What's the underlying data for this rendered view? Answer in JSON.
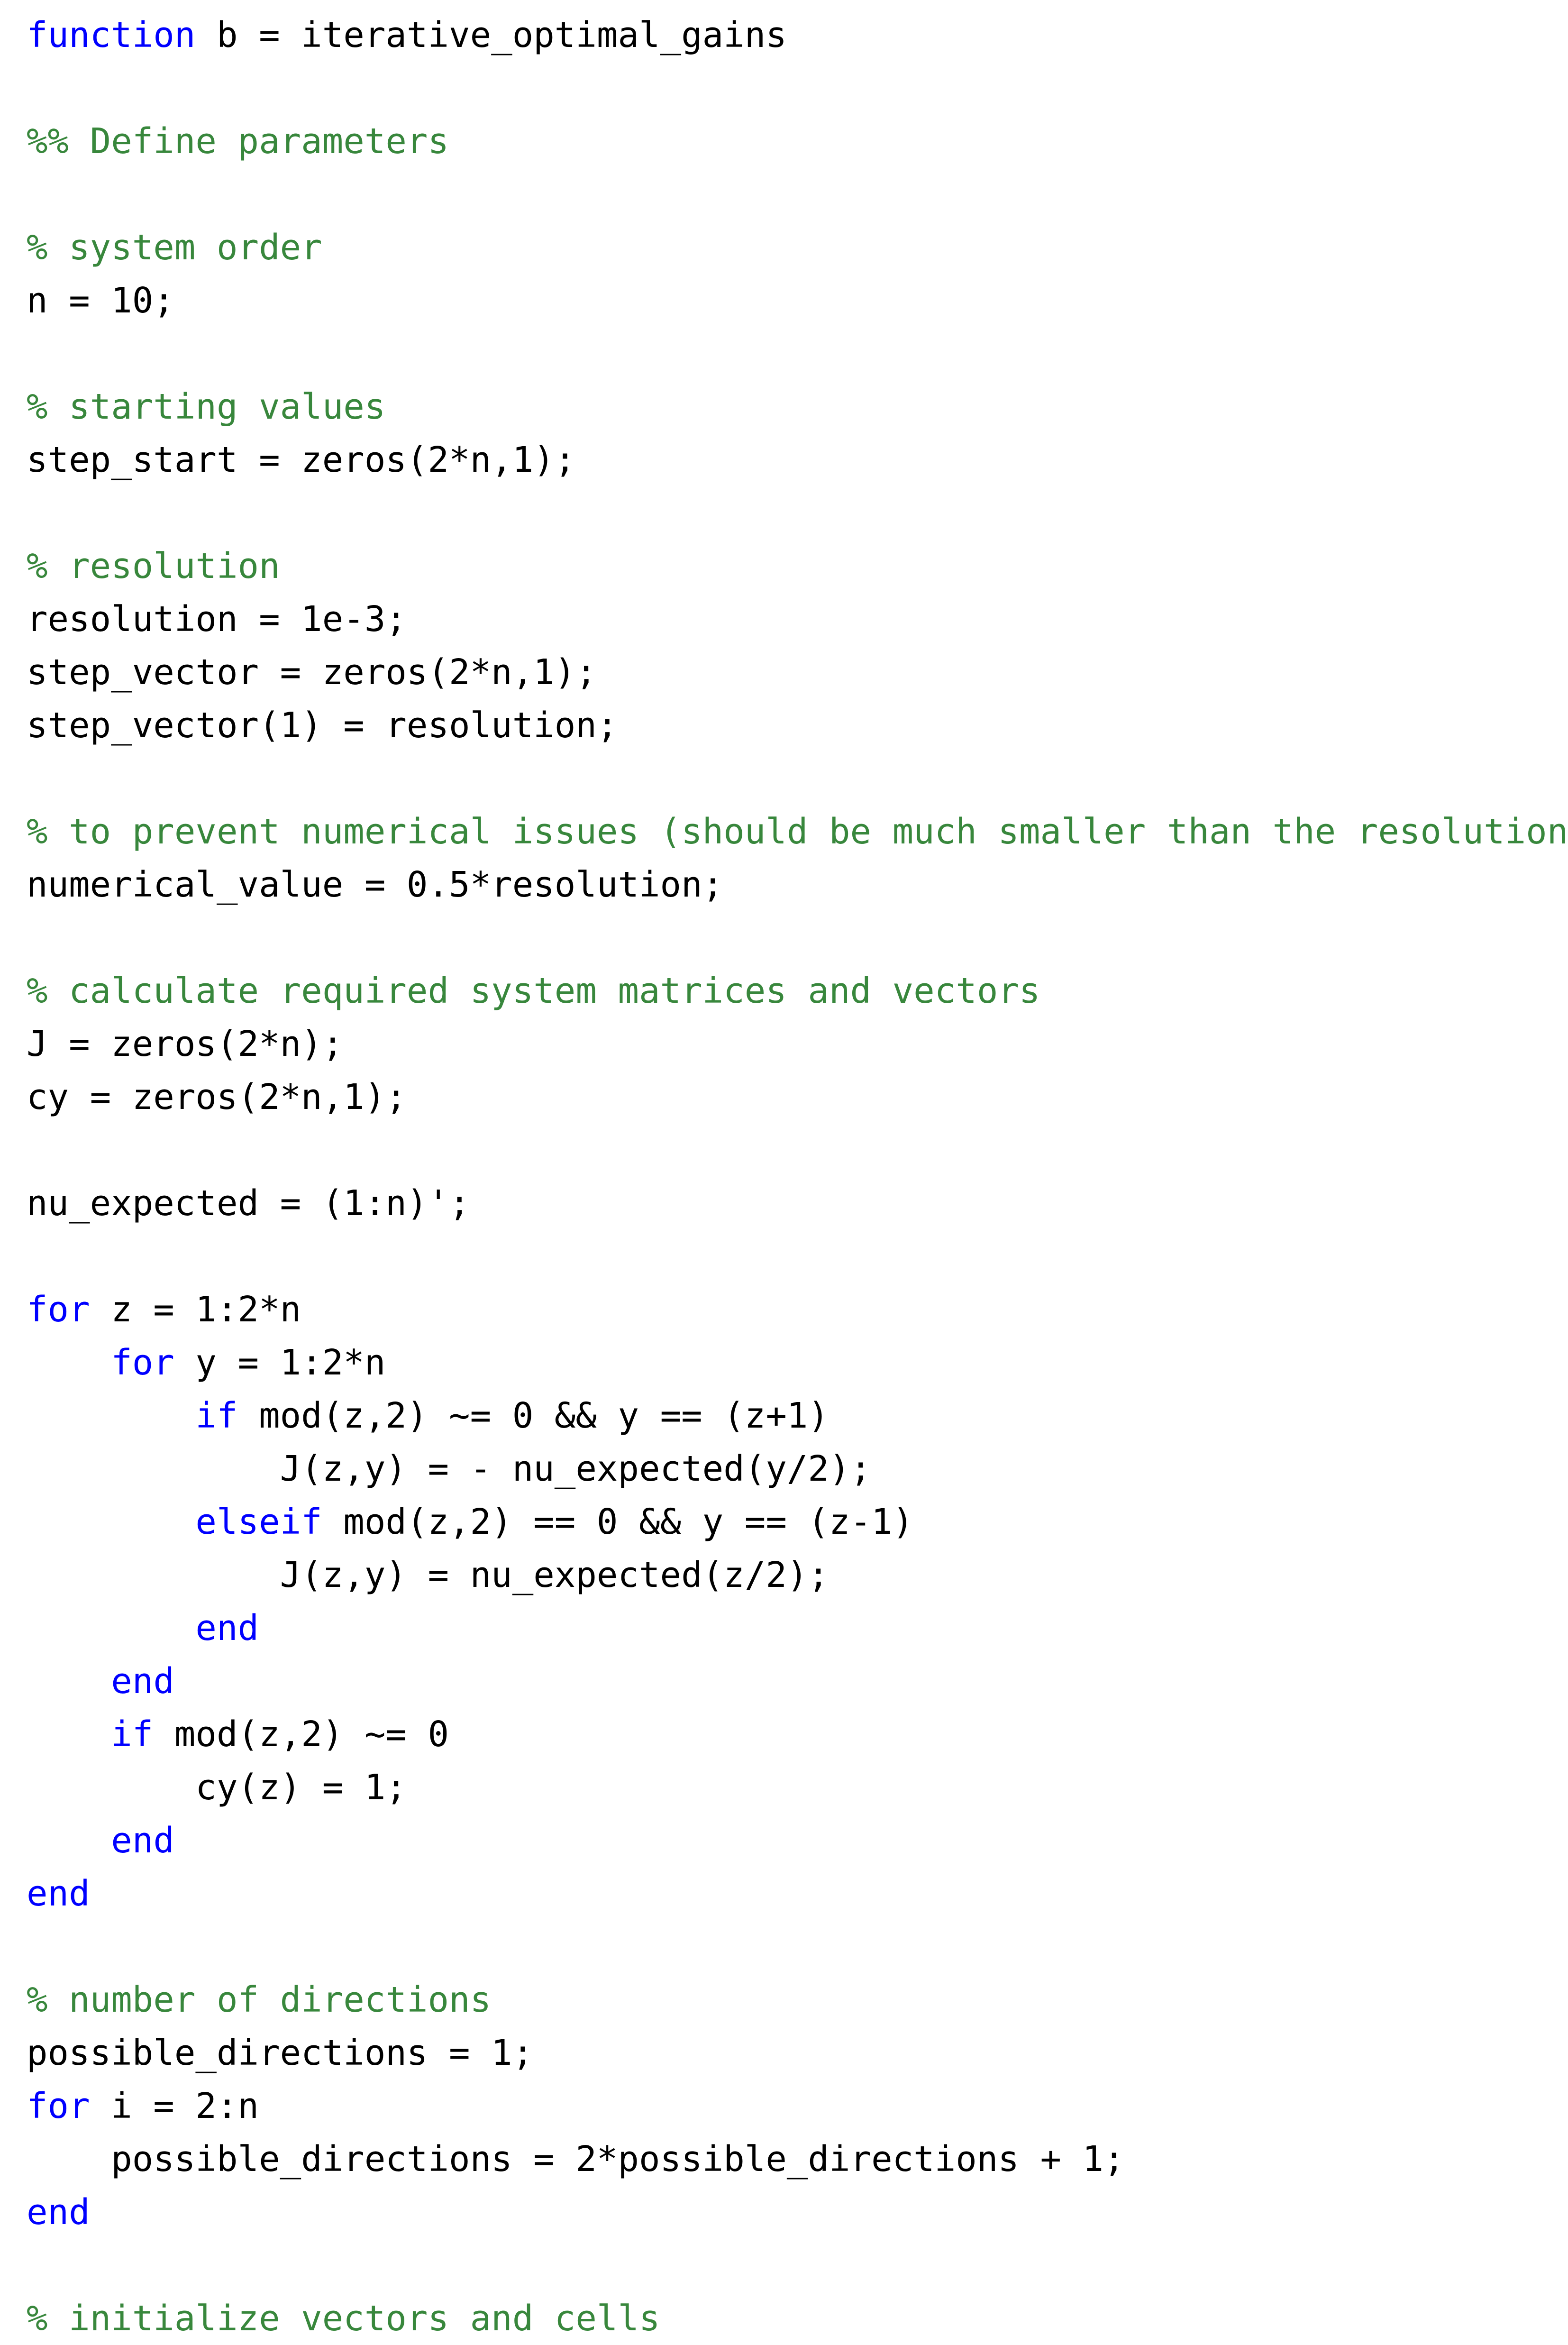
{
  "document": {
    "kind": "matlab-source-listing",
    "function_name": "iterative_optimal_gains",
    "colors": {
      "keyword": "#0000ff",
      "comment": "#38873c",
      "code": "#000000",
      "background": "#ffffff"
    }
  },
  "lines": [
    {
      "id": "l1",
      "indent": 0,
      "tokens": [
        {
          "t": "function",
          "k": "kw"
        },
        {
          "t": " b = iterative_optimal_gains",
          "k": "plain"
        }
      ]
    },
    {
      "id": "l2",
      "indent": 0,
      "tokens": []
    },
    {
      "id": "l3",
      "indent": 0,
      "tokens": [
        {
          "t": "%% Define parameters",
          "k": "comment"
        }
      ]
    },
    {
      "id": "l4",
      "indent": 0,
      "tokens": []
    },
    {
      "id": "l5",
      "indent": 0,
      "tokens": [
        {
          "t": "% system order",
          "k": "comment"
        }
      ]
    },
    {
      "id": "l6",
      "indent": 0,
      "tokens": [
        {
          "t": "n = 10;",
          "k": "plain"
        }
      ]
    },
    {
      "id": "l7",
      "indent": 0,
      "tokens": []
    },
    {
      "id": "l8",
      "indent": 0,
      "tokens": [
        {
          "t": "% starting values",
          "k": "comment"
        }
      ]
    },
    {
      "id": "l9",
      "indent": 0,
      "tokens": [
        {
          "t": "step_start = zeros(2*n,1);",
          "k": "plain"
        }
      ]
    },
    {
      "id": "l10",
      "indent": 0,
      "tokens": []
    },
    {
      "id": "l11",
      "indent": 0,
      "tokens": [
        {
          "t": "% resolution",
          "k": "comment"
        }
      ]
    },
    {
      "id": "l12",
      "indent": 0,
      "tokens": [
        {
          "t": "resolution = 1e-3;",
          "k": "plain"
        }
      ]
    },
    {
      "id": "l13",
      "indent": 0,
      "tokens": [
        {
          "t": "step_vector = zeros(2*n,1);",
          "k": "plain"
        }
      ]
    },
    {
      "id": "l14",
      "indent": 0,
      "tokens": [
        {
          "t": "step_vector(1) = resolution;",
          "k": "plain"
        }
      ]
    },
    {
      "id": "l15",
      "indent": 0,
      "tokens": []
    },
    {
      "id": "l16",
      "indent": 0,
      "tokens": [
        {
          "t": "% to prevent numerical issues (should be much smaller than the resolution)",
          "k": "comment"
        }
      ]
    },
    {
      "id": "l17",
      "indent": 0,
      "tokens": [
        {
          "t": "numerical_value = 0.5*resolution;",
          "k": "plain"
        }
      ]
    },
    {
      "id": "l18",
      "indent": 0,
      "tokens": []
    },
    {
      "id": "l19",
      "indent": 0,
      "tokens": [
        {
          "t": "% calculate required system matrices and vectors",
          "k": "comment"
        }
      ]
    },
    {
      "id": "l20",
      "indent": 0,
      "tokens": [
        {
          "t": "J = zeros(2*n);",
          "k": "plain"
        }
      ]
    },
    {
      "id": "l21",
      "indent": 0,
      "tokens": [
        {
          "t": "cy = zeros(2*n,1);",
          "k": "plain"
        }
      ]
    },
    {
      "id": "l22",
      "indent": 0,
      "tokens": []
    },
    {
      "id": "l23",
      "indent": 0,
      "tokens": [
        {
          "t": "nu_expected = (1:n)';",
          "k": "plain"
        }
      ]
    },
    {
      "id": "l24",
      "indent": 0,
      "tokens": []
    },
    {
      "id": "l25",
      "indent": 0,
      "tokens": [
        {
          "t": "for",
          "k": "kw"
        },
        {
          "t": " z = 1:2*n",
          "k": "plain"
        }
      ]
    },
    {
      "id": "l26",
      "indent": 4,
      "tokens": [
        {
          "t": "for",
          "k": "kw"
        },
        {
          "t": " y = 1:2*n",
          "k": "plain"
        }
      ]
    },
    {
      "id": "l27",
      "indent": 8,
      "tokens": [
        {
          "t": "if",
          "k": "kw"
        },
        {
          "t": " mod(z,2) ~= 0 && y == (z+1)",
          "k": "plain"
        }
      ]
    },
    {
      "id": "l28",
      "indent": 12,
      "tokens": [
        {
          "t": "J(z,y) = - nu_expected(y/2);",
          "k": "plain"
        }
      ]
    },
    {
      "id": "l29",
      "indent": 8,
      "tokens": [
        {
          "t": "elseif",
          "k": "kw"
        },
        {
          "t": " mod(z,2) == 0 && y == (z-1)",
          "k": "plain"
        }
      ]
    },
    {
      "id": "l30",
      "indent": 12,
      "tokens": [
        {
          "t": "J(z,y) = nu_expected(z/2);",
          "k": "plain"
        }
      ]
    },
    {
      "id": "l31",
      "indent": 8,
      "tokens": [
        {
          "t": "end",
          "k": "kw"
        }
      ]
    },
    {
      "id": "l32",
      "indent": 4,
      "tokens": [
        {
          "t": "end",
          "k": "kw"
        }
      ]
    },
    {
      "id": "l33",
      "indent": 4,
      "tokens": [
        {
          "t": "if",
          "k": "kw"
        },
        {
          "t": " mod(z,2) ~= 0",
          "k": "plain"
        }
      ]
    },
    {
      "id": "l34",
      "indent": 8,
      "tokens": [
        {
          "t": "cy(z) = 1;",
          "k": "plain"
        }
      ]
    },
    {
      "id": "l35",
      "indent": 4,
      "tokens": [
        {
          "t": "end",
          "k": "kw"
        }
      ]
    },
    {
      "id": "l36",
      "indent": 0,
      "tokens": [
        {
          "t": "end",
          "k": "kw"
        }
      ]
    },
    {
      "id": "l37",
      "indent": 0,
      "tokens": []
    },
    {
      "id": "l38",
      "indent": 0,
      "tokens": [
        {
          "t": "% number of directions",
          "k": "comment"
        }
      ]
    },
    {
      "id": "l39",
      "indent": 0,
      "tokens": [
        {
          "t": "possible_directions = 1;",
          "k": "plain"
        }
      ]
    },
    {
      "id": "l40",
      "indent": 0,
      "tokens": [
        {
          "t": "for",
          "k": "kw"
        },
        {
          "t": " i = 2:n",
          "k": "plain"
        }
      ]
    },
    {
      "id": "l41",
      "indent": 4,
      "tokens": [
        {
          "t": "possible_directions = 2*possible_directions + 1;",
          "k": "plain"
        }
      ]
    },
    {
      "id": "l42",
      "indent": 0,
      "tokens": [
        {
          "t": "end",
          "k": "kw"
        }
      ]
    },
    {
      "id": "l43",
      "indent": 0,
      "tokens": []
    },
    {
      "id": "l44",
      "indent": 0,
      "tokens": [
        {
          "t": "% initialize vectors and cells",
          "k": "comment"
        }
      ]
    }
  ]
}
